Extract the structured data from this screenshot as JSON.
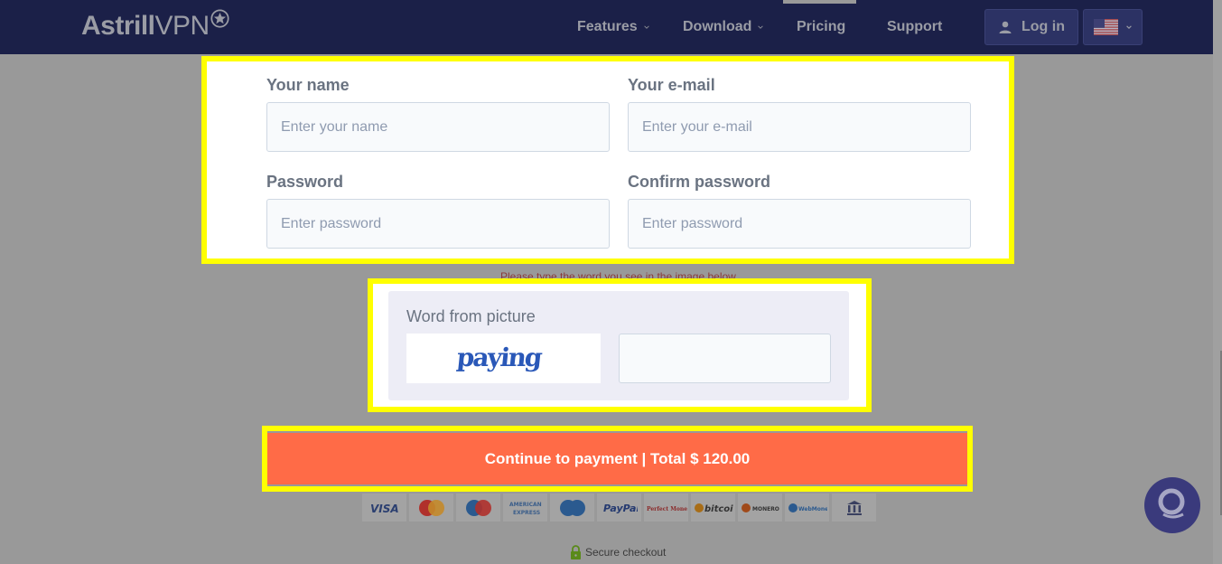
{
  "header": {
    "logo": {
      "bold": "Astrill",
      "light": "VPN"
    },
    "nav": [
      {
        "label": "Features",
        "has_dropdown": true
      },
      {
        "label": "Download",
        "has_dropdown": true
      },
      {
        "label": "Pricing",
        "has_dropdown": false,
        "active": true
      },
      {
        "label": "Support",
        "has_dropdown": false
      }
    ],
    "login_label": "Log in",
    "language": "us-flag"
  },
  "form": {
    "name": {
      "label": "Your name",
      "placeholder": "Enter your name",
      "value": ""
    },
    "email": {
      "label": "Your e-mail",
      "placeholder": "Enter your e-mail",
      "value": ""
    },
    "password": {
      "label": "Password",
      "placeholder": "Enter password",
      "value": ""
    },
    "confirm_password": {
      "label": "Confirm password",
      "placeholder": "Enter password",
      "value": ""
    }
  },
  "captcha": {
    "hint": "Please type the word you see in the image below",
    "label": "Word from picture",
    "image_word": "paying",
    "value": ""
  },
  "payment": {
    "button_label": "Continue to payment | Total $ 120.00",
    "methods": [
      "VISA",
      "MasterCard",
      "Maestro",
      "American Express",
      "Cirrus",
      "PayPal",
      "Perfect Money",
      "bitcoin",
      "MONERO",
      "WebMoney",
      "Bank transfer"
    ],
    "secure_label": "Secure checkout"
  },
  "colors": {
    "header_bg": "#1b2048",
    "accent": "#ff6b47",
    "highlight": "#ffff00",
    "chat": "#3a3a7c"
  }
}
